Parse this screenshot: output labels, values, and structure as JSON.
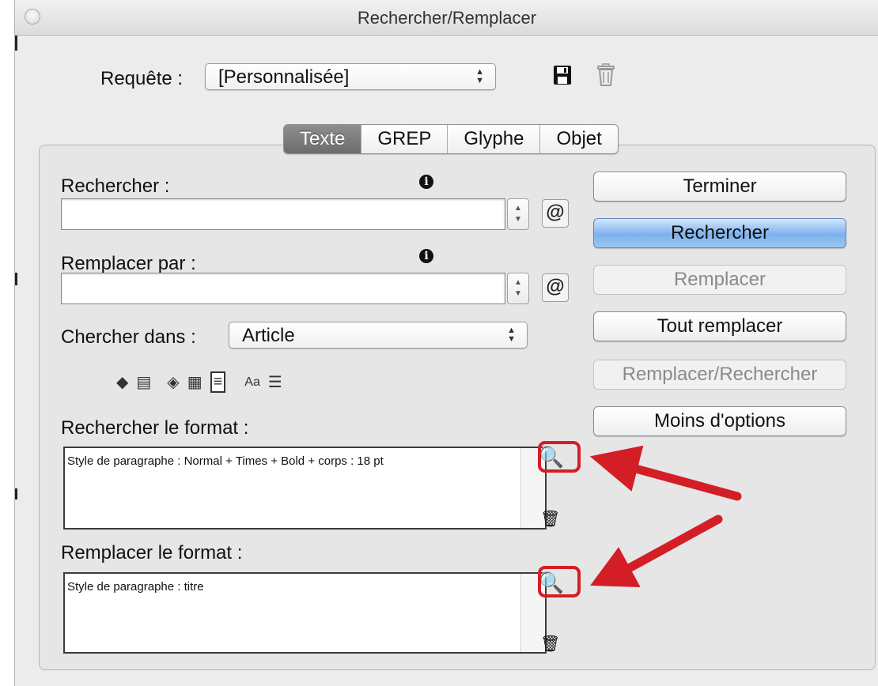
{
  "window": {
    "title": "Rechercher/Remplacer"
  },
  "query": {
    "label": "Requête :",
    "value": "[Personnalisée]"
  },
  "tabs": [
    {
      "label": "Texte",
      "active": true
    },
    {
      "label": "GREP",
      "active": false
    },
    {
      "label": "Glyphe",
      "active": false
    },
    {
      "label": "Objet",
      "active": false
    }
  ],
  "find": {
    "label": "Rechercher :",
    "value": ""
  },
  "replace": {
    "label": "Remplacer par :",
    "value": ""
  },
  "search_in": {
    "label": "Chercher dans :",
    "value": "Article"
  },
  "find_format": {
    "label": "Rechercher le format :",
    "value": "Style de paragraphe : Normal + Times + Bold + corps : 18 pt"
  },
  "replace_format": {
    "label": "Remplacer le format :",
    "value": "Style de paragraphe : titre"
  },
  "buttons": {
    "done": "Terminer",
    "find": "Rechercher",
    "replace": "Remplacer",
    "replace_all": "Tout remplacer",
    "replace_find": "Remplacer/Rechercher",
    "fewer_options": "Moins d'options"
  },
  "icons": {
    "save": "save-icon",
    "delete": "trash-icon",
    "info": "info-icon",
    "special_chars": "at-sign-icon",
    "format": "format-type-icon",
    "stepper": "stepper-icon"
  },
  "colors": {
    "annotation": "#d41e26",
    "primary_button": "#7db1ec",
    "active_tab": "#7a7a7a"
  }
}
